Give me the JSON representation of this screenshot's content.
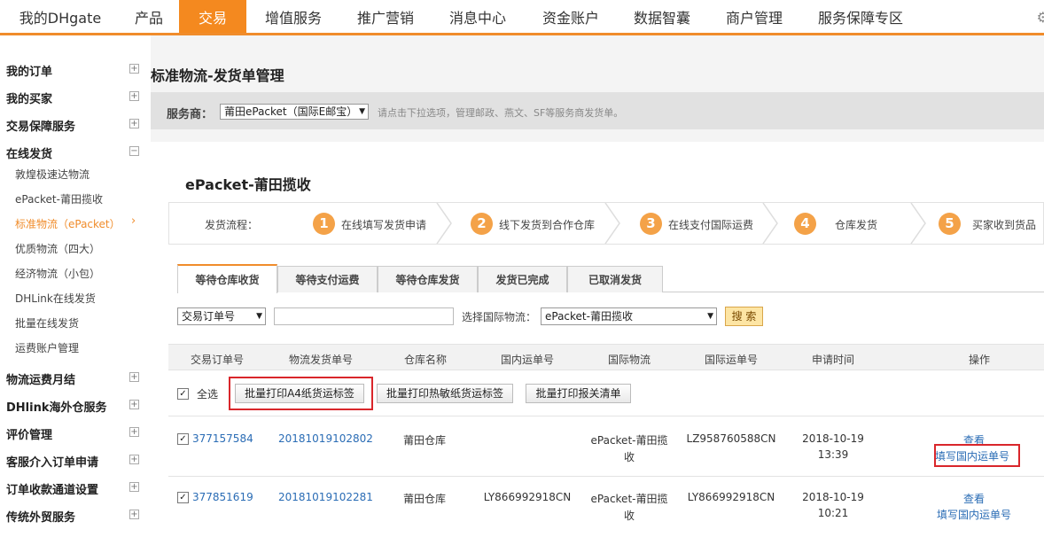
{
  "topnav": {
    "items": [
      "我的DHgate",
      "产品",
      "交易",
      "增值服务",
      "推广营销",
      "消息中心",
      "资金账户",
      "数据智囊",
      "商户管理",
      "服务保障专区"
    ],
    "active_index": 2,
    "accent_color": "#f4891f"
  },
  "sidebar": {
    "sections": [
      {
        "label": "我的订单",
        "toggle": "+"
      },
      {
        "label": "我的买家",
        "toggle": "+"
      },
      {
        "label": "交易保障服务",
        "toggle": "+"
      },
      {
        "label": "在线发货",
        "toggle": "−"
      }
    ],
    "subitems": [
      "敦煌极速达物流",
      "ePacket-莆田揽收",
      "标准物流（ePacket）",
      "优质物流（四大）",
      "经济物流（小包）",
      "DHLink在线发货",
      "批量在线发货",
      "运费账户管理"
    ],
    "active_sub_index": 2,
    "active_arrow": "›",
    "sections_after": [
      {
        "label": "物流运费月结",
        "toggle": "+"
      },
      {
        "label": "DHlink海外仓服务",
        "toggle": "+"
      },
      {
        "label": "评价管理",
        "toggle": "+"
      },
      {
        "label": "客服介入订单申请",
        "toggle": "+"
      },
      {
        "label": "订单收款通道设置",
        "toggle": "+"
      },
      {
        "label": "传统外贸服务",
        "toggle": "+"
      }
    ]
  },
  "page": {
    "title": "标准物流-发货单管理",
    "service_label": "服务商：",
    "service_value": "莆田ePacket（国际E邮宝）",
    "service_hint": "请点击下拉选项，管理邮政、燕文、SF等服务商发货单。"
  },
  "panel": {
    "title": "ePacket-莆田揽收",
    "flow_label": "发货流程：",
    "steps": [
      {
        "num": "1",
        "label": "在线填写发货申请"
      },
      {
        "num": "2",
        "label": "线下发货到合作仓库"
      },
      {
        "num": "3",
        "label": "在线支付国际运费"
      },
      {
        "num": "4",
        "label": "仓库发货"
      },
      {
        "num": "5",
        "label": "买家收到货品"
      }
    ],
    "tabs": [
      "等待仓库收货",
      "等待支付运费",
      "等待仓库发货",
      "发货已完成",
      "已取消发货"
    ],
    "active_tab_index": 0
  },
  "filter": {
    "order_type": "交易订单号",
    "search_value": "",
    "logistics_label": "选择国际物流：",
    "logistics_value": "ePacket-莆田揽收",
    "search_button": "搜 索"
  },
  "table": {
    "headers": [
      "交易订单号",
      "物流发货单号",
      "仓库名称",
      "国内运单号",
      "国际物流",
      "国际运单号",
      "申请时间",
      "操作"
    ],
    "select_all_label": "全选",
    "select_all_checked": true,
    "bulk_buttons": [
      "批量打印A4纸货运标签",
      "批量打印热敏纸货运标签",
      "批量打印报关清单"
    ],
    "rows": [
      {
        "checked": true,
        "order_no": "377157584",
        "shipment_no": "20181019102802",
        "warehouse": "莆田仓库",
        "domestic_no": "",
        "logistics_line1": "ePacket-莆田揽",
        "logistics_line2": "收",
        "intl_no": "LZ958760588CN",
        "date": "2018-10-19",
        "time": "13:39",
        "action_view": "查看",
        "action_fill": "填写国内运单号"
      },
      {
        "checked": true,
        "order_no": "377851619",
        "shipment_no": "20181019102281",
        "warehouse": "莆田仓库",
        "domestic_no": "LY866992918CN",
        "logistics_line1": "ePacket-莆田揽",
        "logistics_line2": "收",
        "intl_no": "LY866992918CN",
        "date": "2018-10-19",
        "time": "10:21",
        "action_view": "查看",
        "action_fill": "填写国内运单号"
      }
    ],
    "check_mark": "✓"
  }
}
